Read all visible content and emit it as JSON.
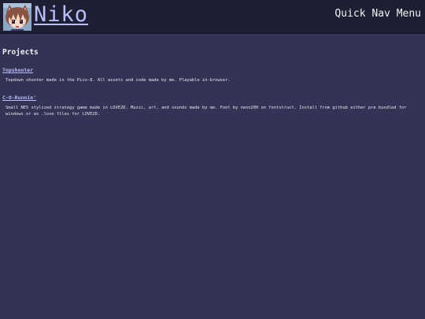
{
  "header": {
    "site_title": "Niko",
    "avatar_icon": "anime-avatar-icon",
    "quick_nav_label": "Quick Nav Menu"
  },
  "main": {
    "section_heading": "Projects",
    "projects": [
      {
        "title": "Topshooter",
        "description": "Topdown shooter made in the Pico-8. All assets and code made by me. Playable in-browser."
      },
      {
        "title": "C-O-Runnin'",
        "description": "Small NES stylized strategy game made in LOVE2D. Music, art, and sounds made by me. Font by neon200 on fontstruct. Install from github either pre bundled for windows or as .love files for LOVE2D."
      }
    ]
  },
  "colors": {
    "page_background": "#333355",
    "header_background": "#1f1f33",
    "link": "#b9bdfb",
    "text": "#e8e8f0"
  }
}
